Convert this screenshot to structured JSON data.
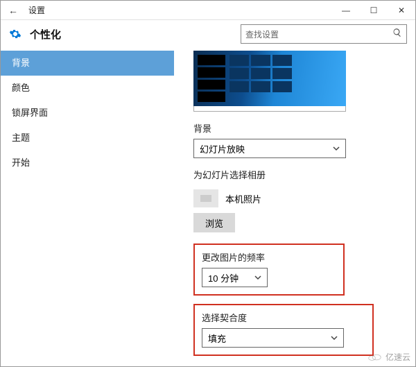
{
  "window": {
    "title": "设置"
  },
  "header": {
    "headline": "个性化",
    "search_placeholder": "查找设置"
  },
  "sidebar": {
    "items": [
      {
        "label": "背景",
        "selected": true
      },
      {
        "label": "颜色"
      },
      {
        "label": "锁屏界面"
      },
      {
        "label": "主题"
      },
      {
        "label": "开始"
      }
    ]
  },
  "content": {
    "bg_label": "背景",
    "bg_value": "幻灯片放映",
    "album_label": "为幻灯片选择相册",
    "album_name": "本机照片",
    "browse_label": "浏览",
    "freq_label": "更改图片的频率",
    "freq_value": "10 分钟",
    "fit_label": "选择契合度",
    "fit_value": "填充"
  },
  "watermark": "亿速云"
}
